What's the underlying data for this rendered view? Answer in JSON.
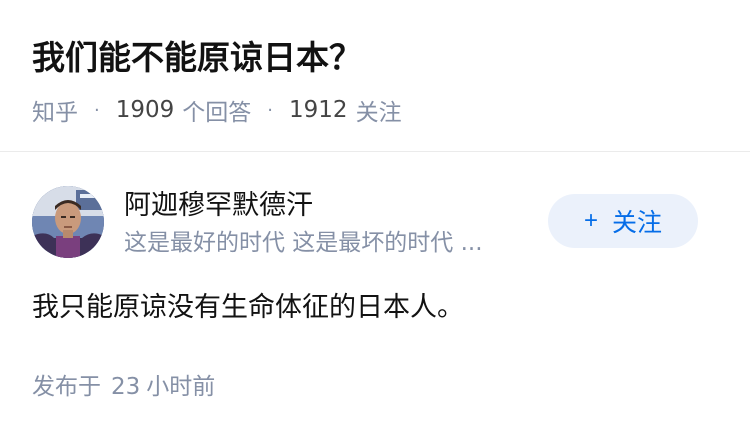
{
  "question": {
    "title": "我们能不能原谅日本？",
    "source": "知乎",
    "answer_count": "1909",
    "answer_label": "个回答",
    "follow_count": "1912",
    "follow_label": "关注",
    "separator": "·"
  },
  "answer": {
    "author": {
      "name": "阿迦穆罕默德汗",
      "bio": "这是最好的时代 这是最坏的时代 ..."
    },
    "follow_button": {
      "icon": "+",
      "label": "关注"
    },
    "content": "我只能原谅没有生命体征的日本人。",
    "published": {
      "prefix": "发布于",
      "value": "23",
      "unit": "小时前"
    }
  },
  "colors": {
    "text_primary": "#121212",
    "text_secondary": "#8590a6",
    "brand_blue": "#056de8",
    "follow_bg": "#ebf1fb",
    "divider": "#ebebeb"
  }
}
